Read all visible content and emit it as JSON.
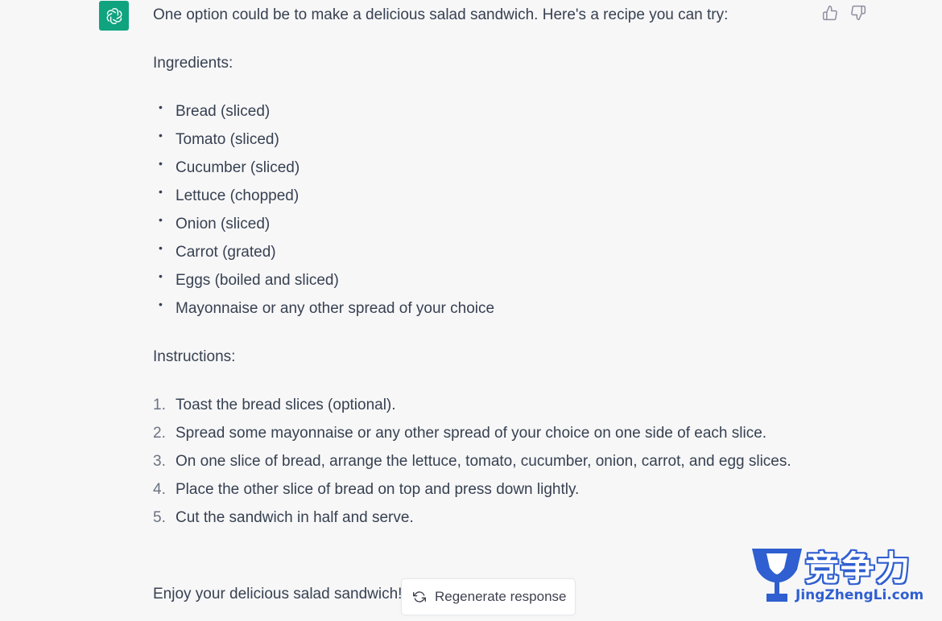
{
  "assistant": {
    "avatar_icon": "openai-logo-icon",
    "avatar_color": "#10a37f"
  },
  "feedback": {
    "thumbs_up_icon": "thumbs-up-icon",
    "thumbs_down_icon": "thumbs-down-icon"
  },
  "message": {
    "intro": "One option could be to make a delicious salad sandwich. Here's a recipe you can try:",
    "ingredients_heading": "Ingredients:",
    "ingredients": [
      "Bread (sliced)",
      "Tomato (sliced)",
      "Cucumber (sliced)",
      "Lettuce (chopped)",
      "Onion (sliced)",
      "Carrot (grated)",
      "Eggs (boiled and sliced)",
      "Mayonnaise or any other spread of your choice"
    ],
    "instructions_heading": "Instructions:",
    "steps": [
      {
        "num": "1.",
        "text": "Toast the bread slices (optional)."
      },
      {
        "num": "2.",
        "text": "Spread some mayonnaise or any other spread of your choice on one side of each slice."
      },
      {
        "num": "3.",
        "text": "On one slice of bread, arrange the lettuce, tomato, cucumber, onion, carrot, and egg slices."
      },
      {
        "num": "4.",
        "text": "Place the other slice of bread on top and press down lightly."
      },
      {
        "num": "5.",
        "text": "Cut the sandwich in half and serve."
      }
    ],
    "outro": "Enjoy your delicious salad sandwich!"
  },
  "regenerate": {
    "label": "Regenerate response",
    "icon": "refresh-icon"
  },
  "watermark": {
    "text": "竞争力",
    "url": "JingZhengLi.com",
    "color": "#2f5fd0"
  }
}
